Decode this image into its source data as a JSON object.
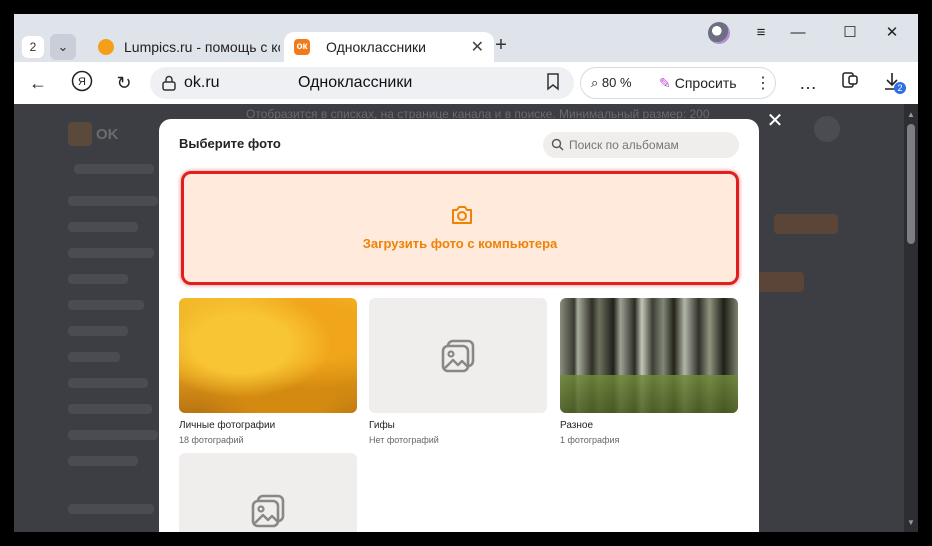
{
  "browser": {
    "tab_count": "2",
    "tabs": [
      {
        "title": "Lumpics.ru - помощь с ком",
        "active": false
      },
      {
        "title": "Одноклассники",
        "active": true
      }
    ],
    "address": {
      "host": "ok.ru",
      "page_title": "Одноклассники"
    },
    "zoom": "80 %",
    "ask_label": "Спросить",
    "downloads_badge": "2"
  },
  "background_page": {
    "logo_text": "OK",
    "notice_text": "Отобразится в списках, на странице канала и в поиске. Минимальный размер: 200"
  },
  "modal": {
    "title": "Выберите фото",
    "search_placeholder": "Поиск по альбомам",
    "upload_label": "Загрузить фото с компьютера",
    "albums": [
      {
        "name": "Личные фотографии",
        "count": "18 фотографий"
      },
      {
        "name": "Гифы",
        "count": "Нет фотографий"
      },
      {
        "name": "Разное",
        "count": "1 фотография"
      }
    ]
  },
  "colors": {
    "accent_orange": "#ee8208",
    "upload_bg": "#ffeadb",
    "highlight_red": "#e01f1f",
    "ok_brand": "#f27a1a"
  }
}
